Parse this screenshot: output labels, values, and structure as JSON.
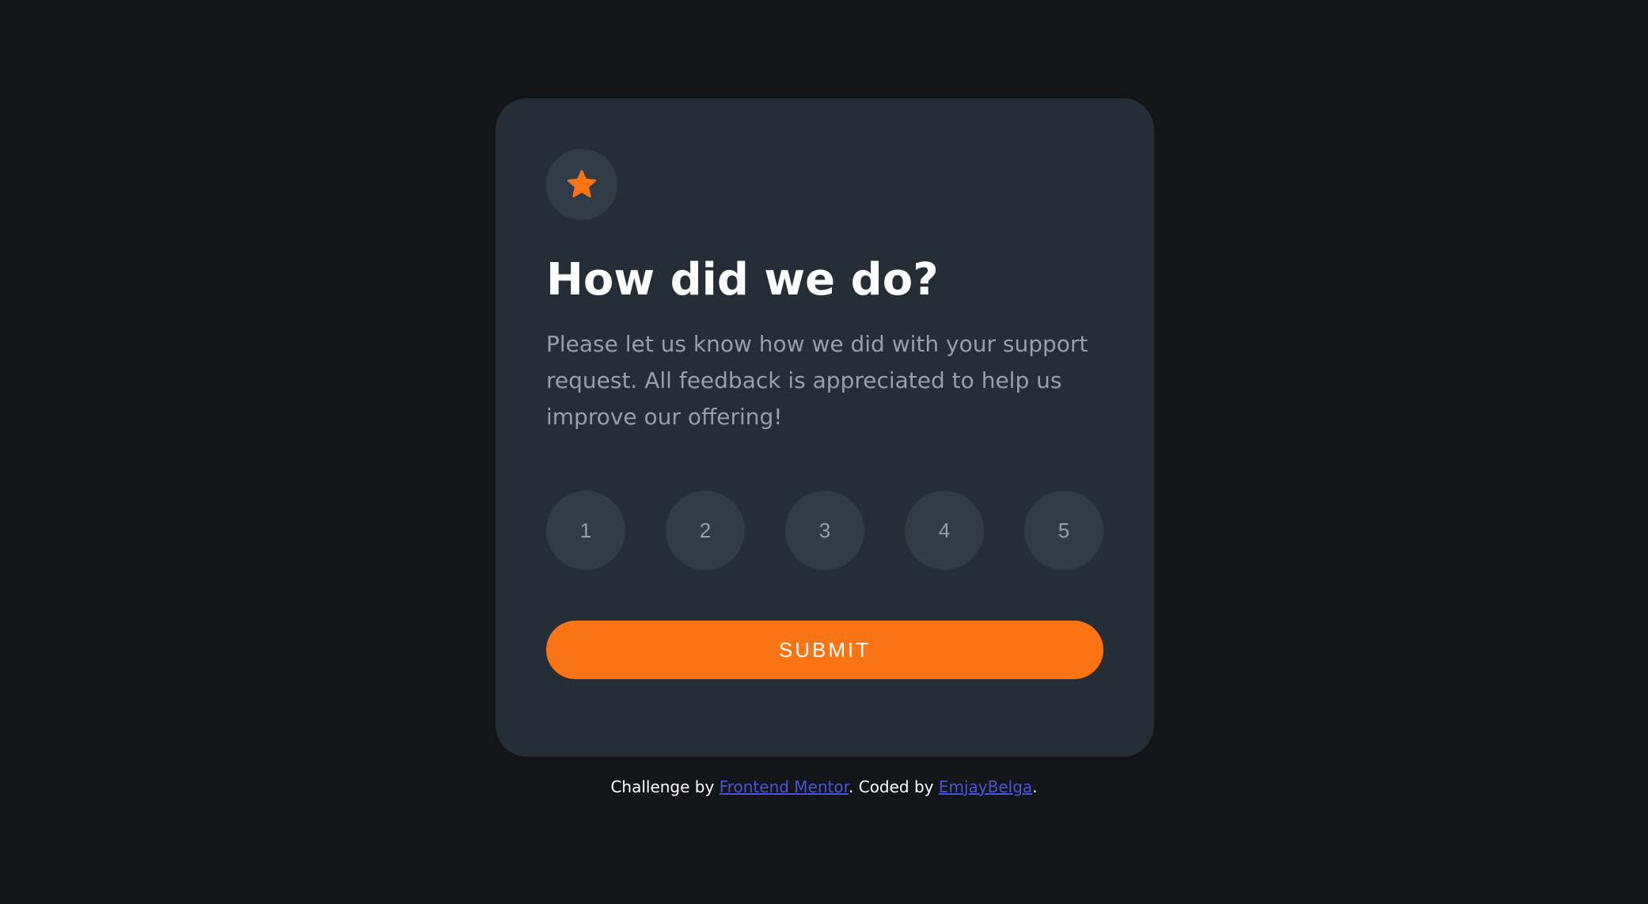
{
  "card": {
    "icon": "star-icon",
    "title": "How did we do?",
    "description": "Please let us know how we did with your support request. All feedback is appreciated to help us improve our offering!",
    "ratings": [
      "1",
      "2",
      "3",
      "4",
      "5"
    ],
    "submit_label": "SUBMIT"
  },
  "attribution": {
    "prefix": "Challenge by ",
    "link1": "Frontend Mentor",
    "middle": ". Coded by ",
    "link2": "EmjayBelga",
    "suffix": "."
  },
  "colors": {
    "background": "#131518",
    "card": "#252d37",
    "circle": "#323b48",
    "accent": "#fb7413",
    "muted_text": "#969fad",
    "link": "#4a55d4"
  }
}
